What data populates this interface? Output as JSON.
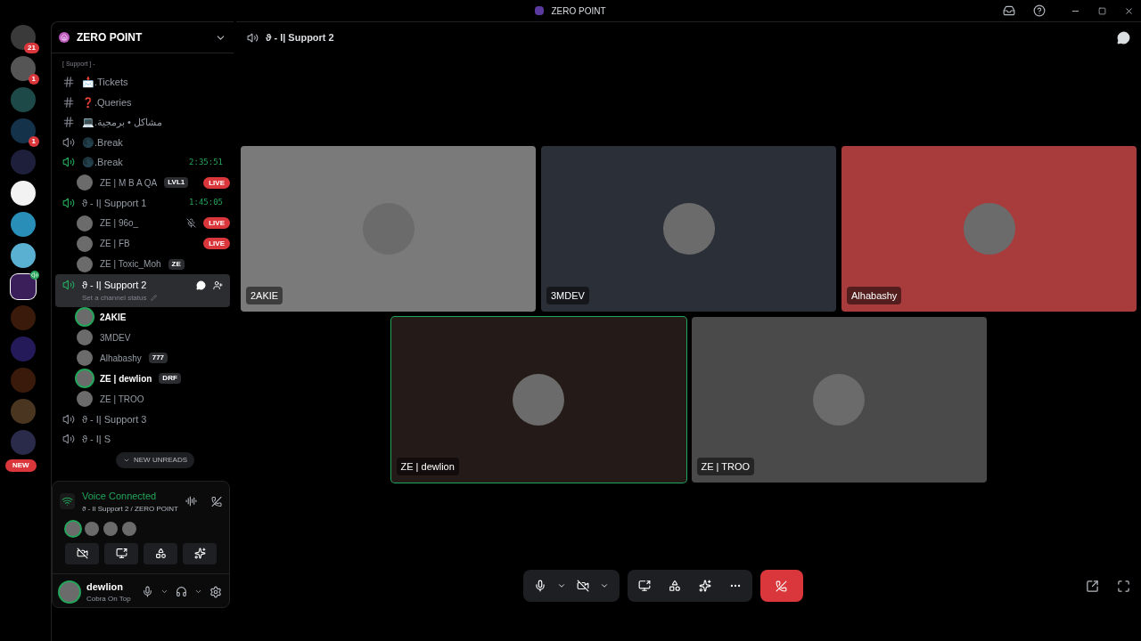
{
  "window": {
    "title": "ZERO POINT"
  },
  "servers": [
    {
      "color": "#3a3a3a",
      "badge": "21",
      "selected": false
    },
    {
      "color": "#555555",
      "badge": "1",
      "selected": false
    },
    {
      "color": "#1d4a48",
      "selected": false
    },
    {
      "color": "#14324a",
      "badge": "1",
      "selected": false
    },
    {
      "color": "#1e1f3a",
      "selected": false
    },
    {
      "color": "#f2f2f2",
      "selected": false
    },
    {
      "color": "#2a8fb8",
      "selected": false
    },
    {
      "color": "#5ab0d0",
      "selected": false
    },
    {
      "color": "#3a1f5a",
      "speaker": true,
      "selected": true
    },
    {
      "color": "#3a1a0a",
      "selected": false
    },
    {
      "color": "#241a5a",
      "selected": false
    },
    {
      "color": "#3a1a0a",
      "selected": false
    },
    {
      "color": "#4a3520",
      "selected": false
    },
    {
      "color": "#2a2a4a",
      "selected": false
    }
  ],
  "new_badge": "NEW",
  "server": {
    "name": "ZERO POINT"
  },
  "category": "[ Support ] -",
  "channels": [
    {
      "kind": "text",
      "name": "📩.Tickets",
      "selected": false
    },
    {
      "kind": "text",
      "name": "❓.Queries",
      "selected": false
    },
    {
      "kind": "text",
      "name": "💻.مشاكل • برمجية",
      "selected": false
    },
    {
      "kind": "voice",
      "name": "🌑.Break",
      "active": false,
      "selected": false
    },
    {
      "kind": "voice",
      "name": "🌑.Break",
      "active": true,
      "timer": "2:35:51",
      "selected": false,
      "members": [
        {
          "name": "ZE | M B A QA",
          "tag": "LVL1",
          "badge": "LIVE",
          "speaking": false
        }
      ]
    },
    {
      "kind": "voice",
      "name": "ϑ - I| Support 1",
      "active": true,
      "timer": "1:45:05",
      "selected": false,
      "members": [
        {
          "name": "ZE | 96o_",
          "badge": "LIVE",
          "muted": true,
          "speaking": false
        },
        {
          "name": "ZE | FB",
          "badge": "LIVE",
          "speaking": false
        },
        {
          "name": "ZE | Toxic_Moh",
          "tag": "ZE",
          "speaking": false
        }
      ]
    },
    {
      "kind": "voice",
      "name": "ϑ - I| Support 2",
      "active": true,
      "selected": true,
      "status": "Set a channel status",
      "members": [
        {
          "name": "2AKIE",
          "speaking": true
        },
        {
          "name": "3MDEV",
          "speaking": false
        },
        {
          "name": "Alhabashy",
          "tag": "777",
          "speaking": false
        },
        {
          "name": "ZE | dewlion",
          "tag": "DRF",
          "speaking": true
        },
        {
          "name": "ZE | TROO",
          "speaking": false
        }
      ]
    },
    {
      "kind": "voice",
      "name": "ϑ - I| Support 3",
      "active": false,
      "selected": false
    },
    {
      "kind": "voice",
      "name": "ϑ - I| S",
      "active": false,
      "selected": false
    }
  ],
  "new_unreads": "NEW UNREADS",
  "voice_panel": {
    "title": "Voice Connected",
    "subtitle": "ϑ - Il Support 2 / ZERO POINT",
    "avatars": [
      {
        "speaking": true
      },
      {
        "speaking": false
      },
      {
        "speaking": false
      },
      {
        "speaking": false
      }
    ]
  },
  "user": {
    "name": "dewlion",
    "status": "Cobra On Top"
  },
  "header": {
    "channel": "ϑ - I| Support 2"
  },
  "tiles": [
    {
      "name": "2AKIE",
      "color": "#7a7a7a",
      "speaking": false
    },
    {
      "name": "3MDEV",
      "color": "#2b2f37",
      "speaking": false
    },
    {
      "name": "Alhabashy",
      "color": "#a83c3c",
      "speaking": false
    },
    {
      "name": "ZE | dewlion",
      "color": "#241a18",
      "speaking": true
    },
    {
      "name": "ZE | TROO",
      "color": "#4a4a4a",
      "speaking": false
    }
  ]
}
